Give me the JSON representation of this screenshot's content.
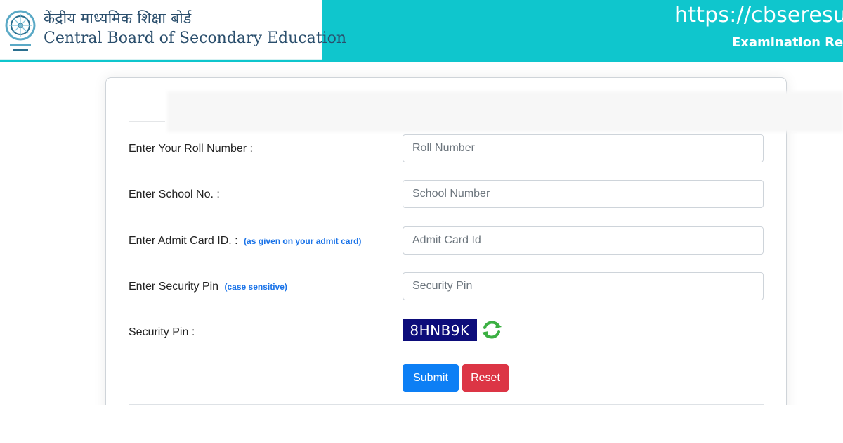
{
  "header": {
    "brand_hindi": "केंद्रीय माध्यमिक शिक्षा बोर्ड",
    "brand_english": "Central Board of Secondary Education",
    "url": "https://cbseresults",
    "subtitle": "Examination Resu"
  },
  "form": {
    "roll": {
      "label": "Enter Your Roll Number :",
      "placeholder": "Roll Number",
      "value": ""
    },
    "school": {
      "label": "Enter School No. :",
      "placeholder": "School Number",
      "value": ""
    },
    "admit": {
      "label": "Enter Admit Card ID. :",
      "hint": "(as given on your admit card)",
      "placeholder": "Admit Card Id",
      "value": ""
    },
    "pin": {
      "label": "Enter Security Pin",
      "hint": "(case sensitive)",
      "placeholder": "Security Pin",
      "value": ""
    },
    "captcha": {
      "label": "Security Pin :",
      "code": "8HNB9K",
      "refresh_icon": "refresh-icon"
    },
    "buttons": {
      "submit": "Submit",
      "reset": "Reset"
    }
  },
  "colors": {
    "header_bg": "#0fc6cd",
    "submit": "#0d7ff5",
    "reset": "#dc3545",
    "captcha_bg": "#0c0c7a",
    "hint_text": "#1a73e8"
  }
}
